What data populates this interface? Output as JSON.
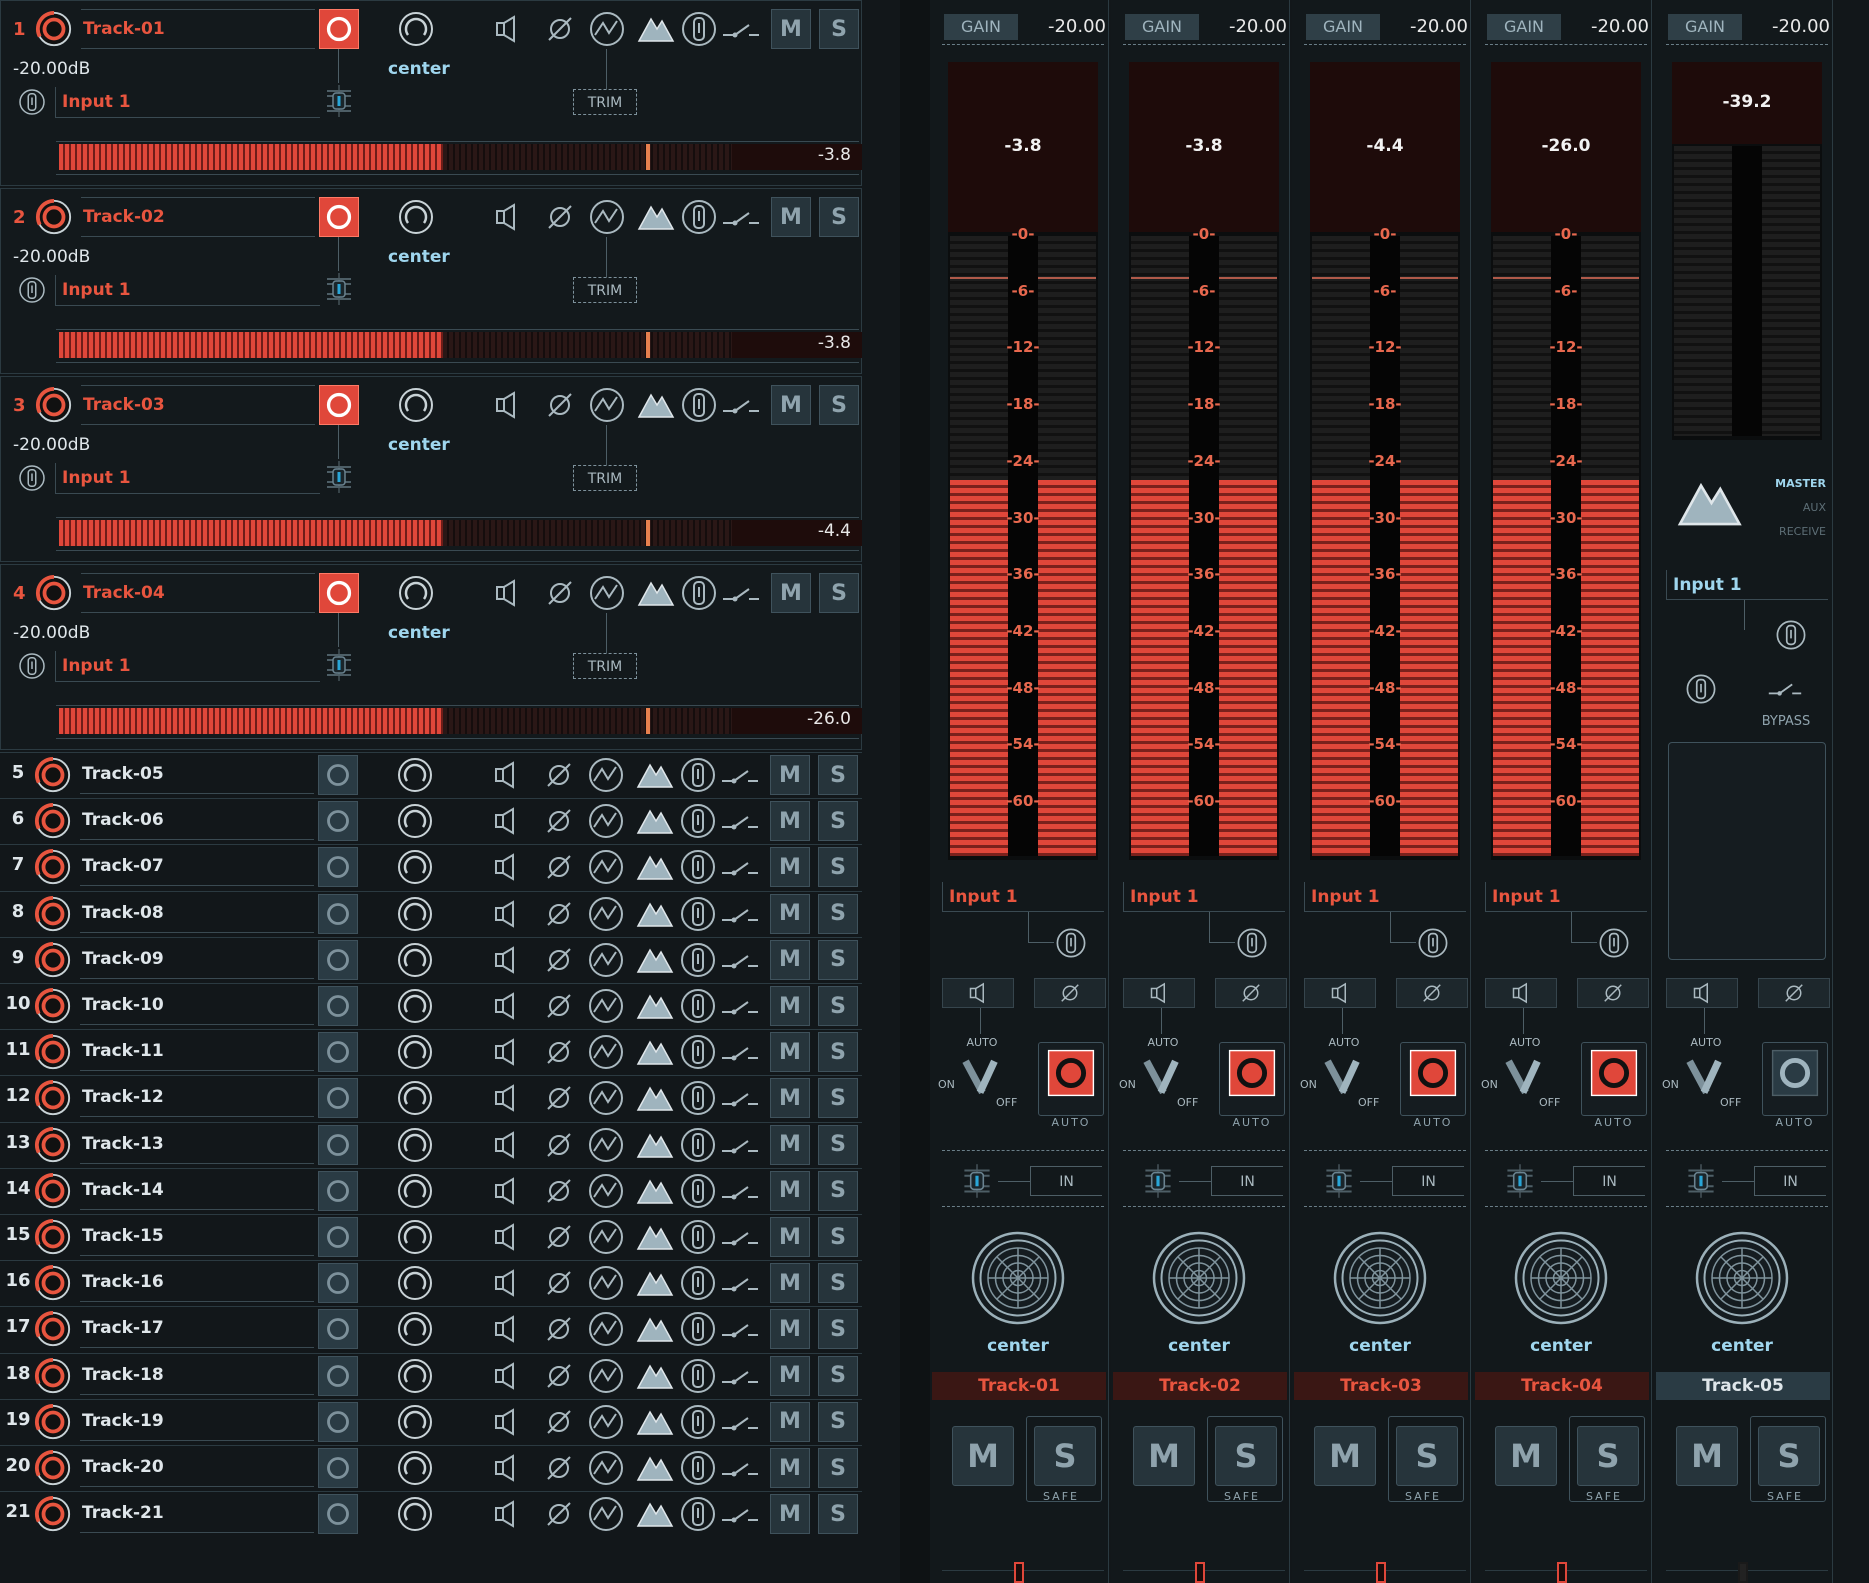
{
  "tracks_expanded": [
    {
      "num": "1",
      "name": "Track-01",
      "gain": "-20.00dB",
      "input": "Input 1",
      "pan": "center",
      "trim": "TRIM",
      "level": "-3.8",
      "fill": 0.63
    },
    {
      "num": "2",
      "name": "Track-02",
      "gain": "-20.00dB",
      "input": "Input 1",
      "pan": "center",
      "trim": "TRIM",
      "level": "-3.8",
      "fill": 0.63
    },
    {
      "num": "3",
      "name": "Track-03",
      "gain": "-20.00dB",
      "input": "Input 1",
      "pan": "center",
      "trim": "TRIM",
      "level": "-4.4",
      "fill": 0.63
    },
    {
      "num": "4",
      "name": "Track-04",
      "gain": "-20.00dB",
      "input": "Input 1",
      "pan": "center",
      "trim": "TRIM",
      "level": "-26.0",
      "fill": 0.63
    }
  ],
  "tracks_collapsed": [
    {
      "num": "5",
      "name": "Track-05"
    },
    {
      "num": "6",
      "name": "Track-06"
    },
    {
      "num": "7",
      "name": "Track-07"
    },
    {
      "num": "8",
      "name": "Track-08"
    },
    {
      "num": "9",
      "name": "Track-09"
    },
    {
      "num": "10",
      "name": "Track-10"
    },
    {
      "num": "11",
      "name": "Track-11"
    },
    {
      "num": "12",
      "name": "Track-12"
    },
    {
      "num": "13",
      "name": "Track-13"
    },
    {
      "num": "14",
      "name": "Track-14"
    },
    {
      "num": "15",
      "name": "Track-15"
    },
    {
      "num": "16",
      "name": "Track-16"
    },
    {
      "num": "17",
      "name": "Track-17"
    },
    {
      "num": "18",
      "name": "Track-18"
    },
    {
      "num": "19",
      "name": "Track-19"
    },
    {
      "num": "20",
      "name": "Track-20"
    },
    {
      "num": "21",
      "name": "Track-21"
    }
  ],
  "labels": {
    "mute": "M",
    "solo": "S",
    "safe": "SAFE",
    "auto": "AUTO",
    "on": "ON",
    "off": "OFF",
    "in": "IN",
    "gain": "GAIN",
    "master": "MASTER",
    "aux": "AUX",
    "receive": "RECEIVE",
    "bypass": "BYPASS"
  },
  "meter_scale": [
    "-0-",
    "-6-",
    "-12-",
    "-18-",
    "-24-",
    "-30-",
    "-36-",
    "-42-",
    "-48-",
    "-54-",
    "-60-"
  ],
  "strips": [
    {
      "name": "Track-01",
      "gain": "-20.00",
      "peak": "-3.8",
      "input": "Input 1",
      "pan": "center",
      "armed": true
    },
    {
      "name": "Track-02",
      "gain": "-20.00",
      "peak": "-3.8",
      "input": "Input 1",
      "pan": "center",
      "armed": true
    },
    {
      "name": "Track-03",
      "gain": "-20.00",
      "peak": "-4.4",
      "input": "Input 1",
      "pan": "center",
      "armed": true
    },
    {
      "name": "Track-04",
      "gain": "-20.00",
      "peak": "-26.0",
      "input": "Input 1",
      "pan": "center",
      "armed": true
    },
    {
      "name": "Track-05",
      "gain": "-20.00",
      "peak": "-39.2",
      "input": "Input 1",
      "pan": "center",
      "armed": false
    }
  ],
  "colors": {
    "accent": "#e8553f",
    "teal": "#2a3b44",
    "text": "#dfe6ea"
  }
}
